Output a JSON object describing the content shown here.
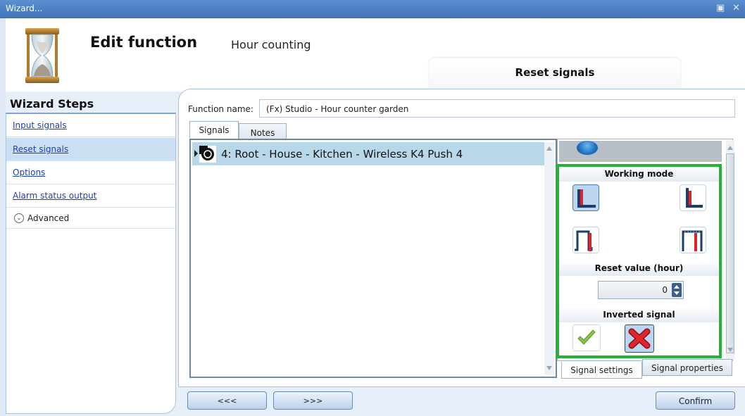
{
  "window": {
    "title": "Wizard...",
    "controls": [
      "restore-icon",
      "close-icon"
    ]
  },
  "header": {
    "title": "Edit function",
    "subtitle": "Hour counting",
    "icon": "hourglass-icon",
    "current_step": "Reset signals"
  },
  "wizard_steps": {
    "title": "Wizard Steps",
    "items": [
      {
        "label": "Input signals",
        "selected": false
      },
      {
        "label": "Reset signals",
        "selected": true
      },
      {
        "label": "Options",
        "selected": false
      },
      {
        "label": "Alarm status output",
        "selected": false
      }
    ],
    "advanced_label": "Advanced"
  },
  "function_name": {
    "label": "Function name:",
    "value": "(Fx) Studio - Hour counter garden"
  },
  "tabs": [
    {
      "label": "Signals",
      "active": true
    },
    {
      "label": "Notes",
      "active": false
    }
  ],
  "signals": [
    {
      "label": "4: Root - House - Kitchen - Wireless K4 Push 4"
    }
  ],
  "settings": {
    "working_mode": {
      "title": "Working mode",
      "options": [
        "level-high",
        "level-low",
        "rising-edge",
        "falling-edge"
      ],
      "selected": "level-high"
    },
    "reset_value": {
      "title": "Reset value (hour)",
      "value": "0"
    },
    "inverted_signal": {
      "title": "Inverted signal",
      "value": false
    }
  },
  "subtabs": [
    {
      "label": "Signal settings",
      "active": true
    },
    {
      "label": "Signal properties",
      "active": false
    }
  ],
  "buttons": {
    "prev": "<<<",
    "next": ">>>",
    "confirm": "Confirm"
  },
  "colors": {
    "highlight_border": "#25b13a",
    "selected_row": "#b8d8ea",
    "link": "#1d3fb8",
    "titlebar": "#4a7fc4"
  }
}
